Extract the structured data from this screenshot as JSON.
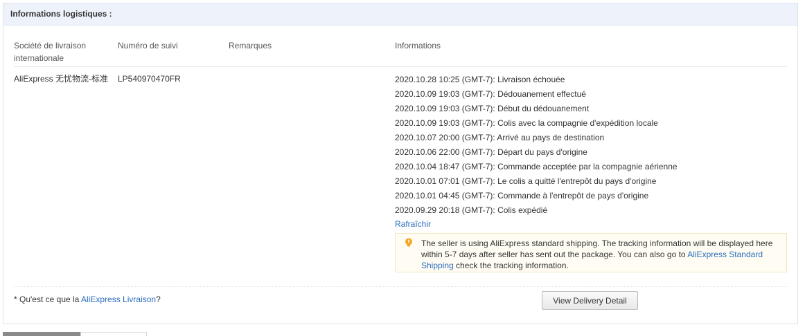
{
  "panel": {
    "title": "Informations logistiques :"
  },
  "table": {
    "headers": {
      "company": "Société de livraison internationale",
      "tracking": "Numéro de suivi",
      "remarks": "Remarques",
      "info": "Informations"
    },
    "row": {
      "company": "AliExpress 无忧物流-标准",
      "tracking": "LP540970470FR",
      "remarks": "",
      "events": [
        "2020.10.28 10:25 (GMT-7): Livraison échouée",
        "2020.10.09 19:03 (GMT-7): Dédouanement effectué",
        "2020.10.09 19:03 (GMT-7): Début du dédouanement",
        "2020.10.09 19:03 (GMT-7): Colis avec la compagnie d'expédition locale",
        "2020.10.07 20:00 (GMT-7): Arrivé au pays de destination",
        "2020.10.06 22:00 (GMT-7): Départ du pays d'origine",
        "2020.10.04 18:47 (GMT-7): Commande acceptée par la compagnie aérienne",
        "2020.10.01 07:01 (GMT-7): Le colis a quitté l'entrepôt du pays d'origine",
        "2020.10.01 04:45 (GMT-7): Commande à l'entrepôt de pays d'origine",
        "2020.09.29 20:18 (GMT-7): Colis expédié"
      ],
      "refresh_label": "Rafraîchir"
    }
  },
  "notice": {
    "icon": "lightbulb-icon",
    "text_before": "The seller is using AliExpress standard shipping. The tracking information will be displayed here within 5-7 days after seller has sent out the package. You can also go to ",
    "link_text": "AliExpress Standard Shipping",
    "text_after": " check the tracking information.",
    "colors": {
      "border": "#f3e7b9",
      "background": "#fffdf3",
      "icon": "#f5a623"
    }
  },
  "footer": {
    "question_before": "* Qu'est ce que la ",
    "question_link": "AliExpress Livraison",
    "question_after": "?",
    "button_label": "View Delivery Detail"
  },
  "colors": {
    "link": "#2a6bbd",
    "header_bg": "#eef3fb",
    "text": "#333333"
  }
}
